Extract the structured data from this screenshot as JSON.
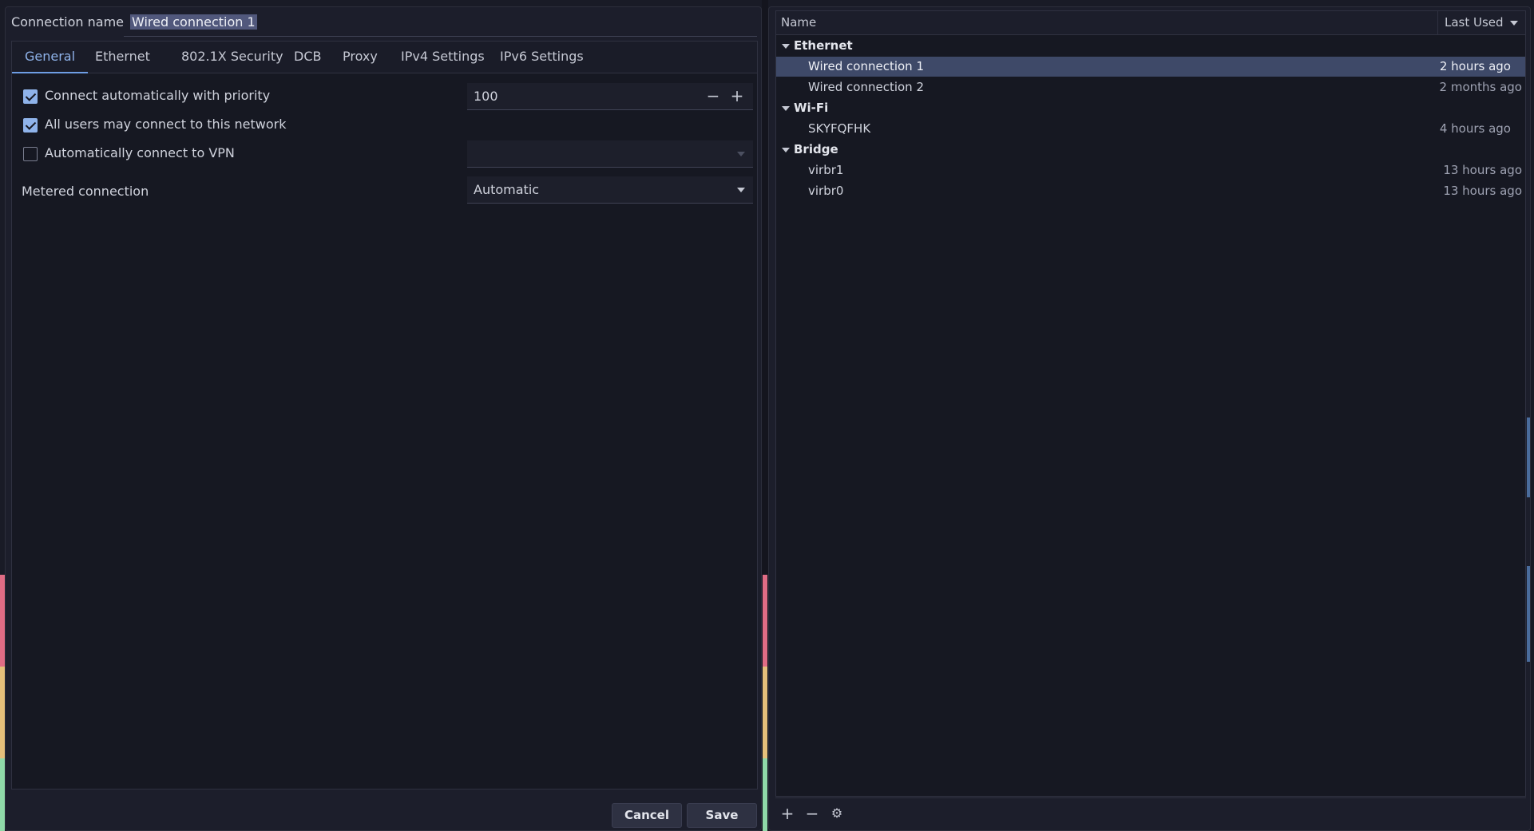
{
  "editor": {
    "connection_name_label": "Connection name",
    "connection_name_value": "Wired connection 1",
    "tabs": [
      {
        "label": "General"
      },
      {
        "label": "Ethernet"
      },
      {
        "label": "802.1X Security"
      },
      {
        "label": "DCB"
      },
      {
        "label": "Proxy"
      },
      {
        "label": "IPv4 Settings"
      },
      {
        "label": "IPv6 Settings"
      }
    ],
    "active_tab": "General",
    "general": {
      "auto_connect_label": "Connect automatically with priority",
      "auto_connect_checked": true,
      "priority_value": "100",
      "all_users_label": "All users may connect to this network",
      "all_users_checked": true,
      "auto_vpn_label": "Automatically connect to VPN",
      "auto_vpn_checked": false,
      "vpn_value": "",
      "metered_label": "Metered connection",
      "metered_value": "Automatic"
    },
    "buttons": {
      "cancel": "Cancel",
      "save": "Save"
    }
  },
  "connections": {
    "header_name": "Name",
    "header_last_used": "Last Used",
    "groups": [
      {
        "label": "Ethernet",
        "items": [
          {
            "name": "Wired connection 1",
            "last_used": "2 hours ago",
            "selected": true
          },
          {
            "name": "Wired connection 2",
            "last_used": "2 months ago",
            "selected": false
          }
        ]
      },
      {
        "label": "Wi-Fi",
        "items": [
          {
            "name": "SKYFQFHK",
            "last_used": "4 hours ago",
            "selected": false
          }
        ]
      },
      {
        "label": "Bridge",
        "items": [
          {
            "name": "virbr1",
            "last_used": "13 hours ago",
            "selected": false
          },
          {
            "name": "virbr0",
            "last_used": "13 hours ago",
            "selected": false
          }
        ]
      }
    ],
    "toolbar_icons": [
      "add-icon",
      "remove-icon",
      "gear-icon"
    ]
  },
  "colors": {
    "accent": "#8fb3ea",
    "selection": "#3e4968",
    "background": "#191b26",
    "stripe_red": "#e06c85",
    "stripe_yellow": "#e5c07b",
    "stripe_green": "#8fd9a8"
  }
}
